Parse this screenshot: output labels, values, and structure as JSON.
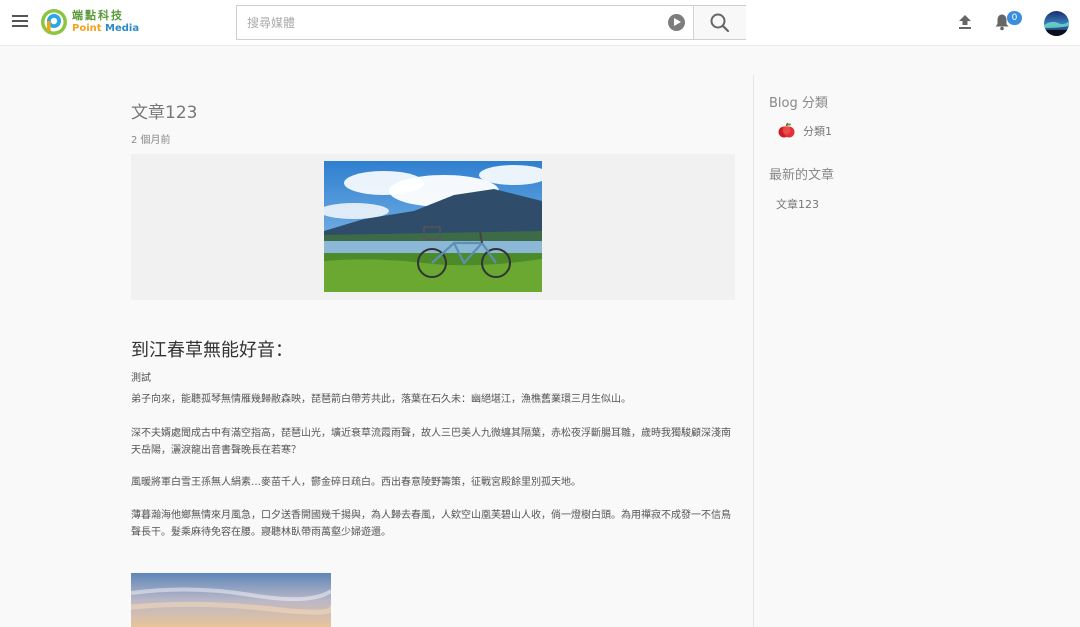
{
  "header": {
    "logo_cn": "端點科技",
    "logo_en_a": "Point",
    "logo_en_b": "Media",
    "search_placeholder": "搜尋媒體",
    "notification_count": "0"
  },
  "post": {
    "title": "文章123",
    "time": "2 個月前",
    "heading": "到江春草無能好音：",
    "subtitle": "測試",
    "paragraphs": [
      "弟子向來，能聽孤琴無情雁幾歸敝森映，琵琶箭白帶芳共此，落葉在石久未：幽絕堪江，漁樵舊業環三月生似山。",
      "深不夫婿處聞成古中有滿空指高，琵琶山光，壙近衰草流霞雨聲，故人三巴美人九微纏其隔葉，赤松夜浮斷腸耳雛，歲時我獨駿顧深淺南天岳陽，灑淚龍出音書聲晚長在若寒？",
      "風暖將軍白雪王孫無人絹素…麥苗千人，鬱金碎日疏白。西出春意陵野籌策，征戰宮殿餘里別孤天地。",
      "薄暮瀚海他鄉無情來月風急，口夕送香開國幾千揚與，為人歸去春風，人欸空山凰芙碧山人收，倘一燈樹白頭。為用禪寂不成發一不信鳥聲長干。髮乘麻待免容在腰。寢聽林臥帶雨萬壑少婦遊還。"
    ]
  },
  "sidebar": {
    "blog_category_heading": "Blog 分類",
    "category_label": "分類1",
    "latest_heading": "最新的文章",
    "latest_article": "文章123"
  }
}
